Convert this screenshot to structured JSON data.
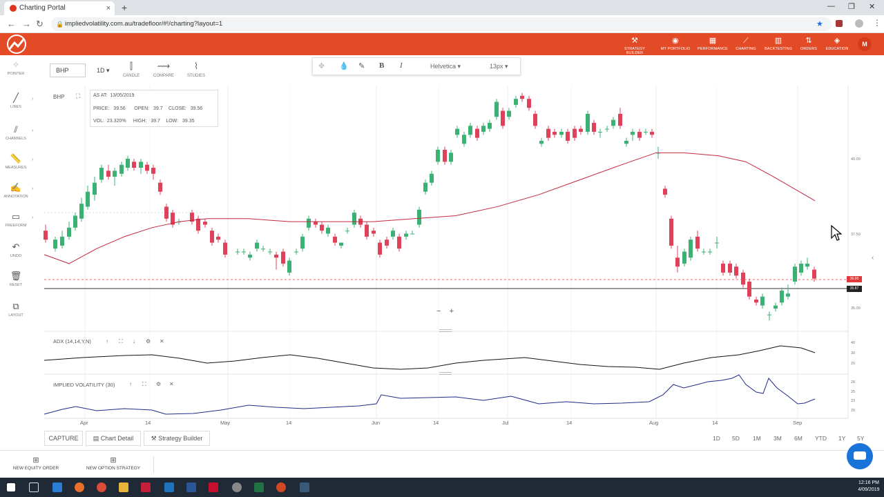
{
  "browser": {
    "tab_title": "Charting Portal",
    "url": "impliedvolatility.com.au/tradefloor/#!/charting?layout=1",
    "new_tab": "+",
    "tab_close": "×"
  },
  "nav": {
    "items": [
      {
        "label": "STRATEGY BUILDER",
        "icon": "tools-icon"
      },
      {
        "label": "MY PORTFOLIO",
        "icon": "camera-icon"
      },
      {
        "label": "PERFORMANCE",
        "icon": "performance-icon"
      },
      {
        "label": "CHARTING",
        "icon": "chart-icon"
      },
      {
        "label": "BACKTESTING",
        "icon": "backtest-icon"
      },
      {
        "label": "ORDERS",
        "icon": "orders-icon"
      },
      {
        "label": "EDUCATION",
        "icon": "education-icon"
      }
    ],
    "user_initial": "M"
  },
  "left_tools": [
    {
      "label": "POINTER",
      "icon": "pointer-icon"
    },
    {
      "label": "LINES",
      "icon": "line-icon"
    },
    {
      "label": "CHANNELS",
      "icon": "channel-icon"
    },
    {
      "label": "MEASURES",
      "icon": "ruler-icon"
    },
    {
      "label": "ANNOTATION",
      "icon": "annotation-icon"
    },
    {
      "label": "FREEFORM",
      "icon": "freeform-icon"
    },
    {
      "label": "UNDO",
      "icon": "undo-icon"
    },
    {
      "label": "RESET",
      "icon": "trash-icon"
    },
    {
      "label": "LAYOUT",
      "icon": "layout-icon"
    }
  ],
  "toolbar": {
    "symbol": "BHP",
    "interval": "1D",
    "candle": "CANDLE",
    "compare": "COMPARE",
    "studies": "STUDIES"
  },
  "format_bar": {
    "bold": "B",
    "italic": "I",
    "font": "Helvetica",
    "size": "13px"
  },
  "chart": {
    "symbol": "BHP",
    "ohlc": {
      "as_at_label": "AS AT:",
      "as_at": "13/05/2019",
      "price_label": "PRICE:",
      "price": "39.56",
      "open_label": "OPEN:",
      "open": "39.7",
      "close_label": "CLOSE:",
      "close": "39.56",
      "vol_label": "VOL:",
      "vol": "23.320%",
      "high_label": "HIGH:",
      "high": "39.7",
      "low_label": "LOW:",
      "low": "39.35"
    },
    "price_axis": [
      "40.00",
      "37.50",
      "35.00"
    ],
    "last_tags": [
      {
        "value": "36.00",
        "color": "#e03a3a"
      },
      {
        "value": "35.87",
        "color": "#222222"
      }
    ],
    "zoom_out": "−",
    "zoom_in": "+",
    "colors": {
      "up": "#3bb273",
      "down": "#e0415a",
      "ma": "#c0273d",
      "ind": "#1f2a8a"
    }
  },
  "indicators": {
    "adx": {
      "label": "ADX (14,14,Y,N)",
      "axis": [
        "40",
        "30",
        "20"
      ]
    },
    "iv": {
      "label": "IMPLIED VOLATILITY (30)",
      "axis": [
        "28",
        "25",
        "23",
        "20"
      ]
    }
  },
  "x_axis": [
    "Apr",
    "14",
    "May",
    "14",
    "Jun",
    "14",
    "Jul",
    "14",
    "Aug",
    "14",
    "Sep"
  ],
  "bottom": {
    "capture": "CAPTURE",
    "chart_detail": "Chart Detail",
    "strategy_builder": "Strategy Builder",
    "timeframes": [
      "1D",
      "5D",
      "1M",
      "3M",
      "6M",
      "YTD",
      "1Y",
      "5Y"
    ]
  },
  "orders": {
    "equity": "NEW EQUITY ORDER",
    "option": "NEW OPTION STRATEGY"
  },
  "taskbar": {
    "time": "12:16 PM",
    "date": "4/09/2019"
  }
}
